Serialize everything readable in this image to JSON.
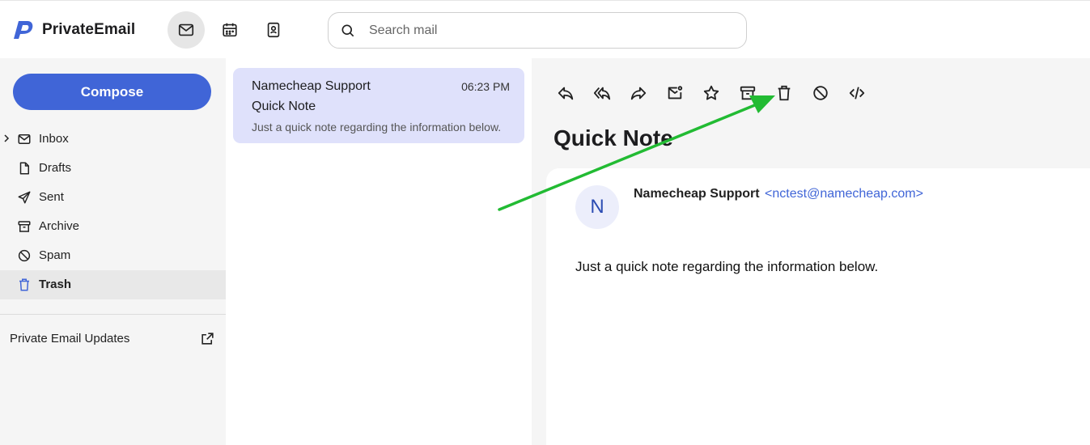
{
  "brand": {
    "name": "PrivateEmail",
    "accent": "#4065d7"
  },
  "app_switcher": [
    {
      "icon": "mail-icon",
      "active": true
    },
    {
      "icon": "calendar-icon",
      "active": false
    },
    {
      "icon": "contacts-icon",
      "active": false
    }
  ],
  "search": {
    "placeholder": "Search mail",
    "value": ""
  },
  "sidebar": {
    "compose_label": "Compose",
    "folders": [
      {
        "label": "Inbox",
        "icon": "envelope-icon",
        "active": false,
        "expandable": true
      },
      {
        "label": "Drafts",
        "icon": "file-icon",
        "active": false
      },
      {
        "label": "Sent",
        "icon": "send-icon",
        "active": false
      },
      {
        "label": "Archive",
        "icon": "archive-icon",
        "active": false
      },
      {
        "label": "Spam",
        "icon": "block-icon",
        "active": false
      },
      {
        "label": "Trash",
        "icon": "trash-icon",
        "active": true
      }
    ],
    "updates_label": "Private Email Updates"
  },
  "message_list": [
    {
      "sender": "Namecheap Support",
      "time": "06:23 PM",
      "subject": "Quick Note",
      "preview": "Just a quick note regarding the information below.",
      "selected": true,
      "highlight_color": "#dfe1fb"
    }
  ],
  "toolbar": [
    {
      "icon": "reply-icon"
    },
    {
      "icon": "reply-all-icon"
    },
    {
      "icon": "forward-icon"
    },
    {
      "icon": "mark-unread-icon"
    },
    {
      "icon": "star-icon"
    },
    {
      "icon": "archive-icon"
    },
    {
      "icon": "delete-icon"
    },
    {
      "icon": "block-sender-icon"
    },
    {
      "icon": "view-source-icon"
    }
  ],
  "message": {
    "title": "Quick Note",
    "avatar_letter": "N",
    "from_name": "Namecheap Support",
    "from_email": "<nctest@namecheap.com>",
    "body": "Just a quick note regarding the information below."
  },
  "annotation": {
    "color": "#22bb33",
    "target": "delete-icon"
  }
}
